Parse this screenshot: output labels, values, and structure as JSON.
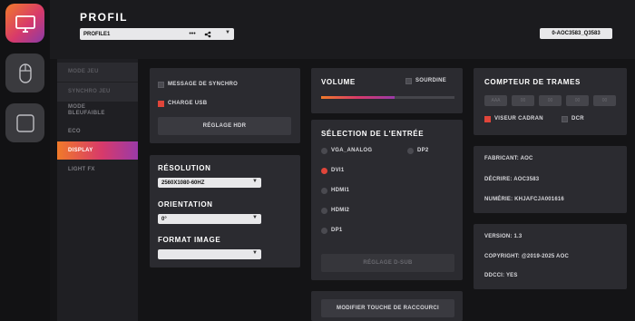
{
  "app": {
    "title": "PROFIL"
  },
  "header": {
    "profile_value": "PROFILE1",
    "device": "0-AOC3583_Q3583"
  },
  "rail": [
    {
      "name": "display-icon",
      "active": true
    },
    {
      "name": "mouse-icon",
      "active": false
    },
    {
      "name": "square-icon",
      "active": false
    }
  ],
  "subnav": [
    "MODE JEU",
    "SYNCHRO JEU",
    "MODE BLEUFAIBLE",
    "ECO",
    "DISPLAY",
    "LIGHT FX"
  ],
  "display_card": {
    "sync_label": "MESSAGE DE SYNCHRO",
    "sync_checked": false,
    "usb_label": "CHARGE USB",
    "usb_checked": true,
    "hdr_button": "RÉGLAGE HDR"
  },
  "resolution_card": {
    "resolution_title": "RÉSOLUTION",
    "resolution_value": "2560X1080-60HZ",
    "orientation_title": "ORIENTATION",
    "orientation_value": "0°",
    "format_title": "FORMAT IMAGE",
    "format_value": ""
  },
  "volume_card": {
    "title": "VOLUME",
    "mute_label": "SOURDINE",
    "mute_checked": false,
    "level_percent": 55
  },
  "input_card": {
    "title": "SÉLECTION DE L'ENTRÉE",
    "inputs": [
      "VGA_ANALOG",
      "DP2",
      "DVI1",
      "HDMI1",
      "HDMI2",
      "DP1"
    ],
    "selected": "DVI1",
    "dsub_button": "RÉGLAGE D-SUB"
  },
  "shortcut_button": "MODIFIER TOUCHE DE RACCOURCI",
  "frame_card": {
    "title": "COMPTEUR DE TRAMES",
    "fields": [
      "AAA",
      "00",
      "00",
      "00",
      "00"
    ],
    "viewer_label": "VISEUR CADRAN",
    "viewer_checked": true,
    "dcr_label": "DCR",
    "dcr_checked": false
  },
  "maker_card": {
    "fabricant": "FABRICANT: AOC",
    "decrire": "DÉCRIRE: AOC3583",
    "serial": "NUMÉRIE: KHJAFCJA001616"
  },
  "version_card": {
    "version": "VERSION: 1.3",
    "copyright": "COPYRIGHT: @2019-2025 AOC",
    "ddcci": "DDCCI: YES"
  },
  "colors": {
    "accent": "#e0453a",
    "gradient_start": "#f07a2a",
    "gradient_end": "#9a3aa8"
  }
}
